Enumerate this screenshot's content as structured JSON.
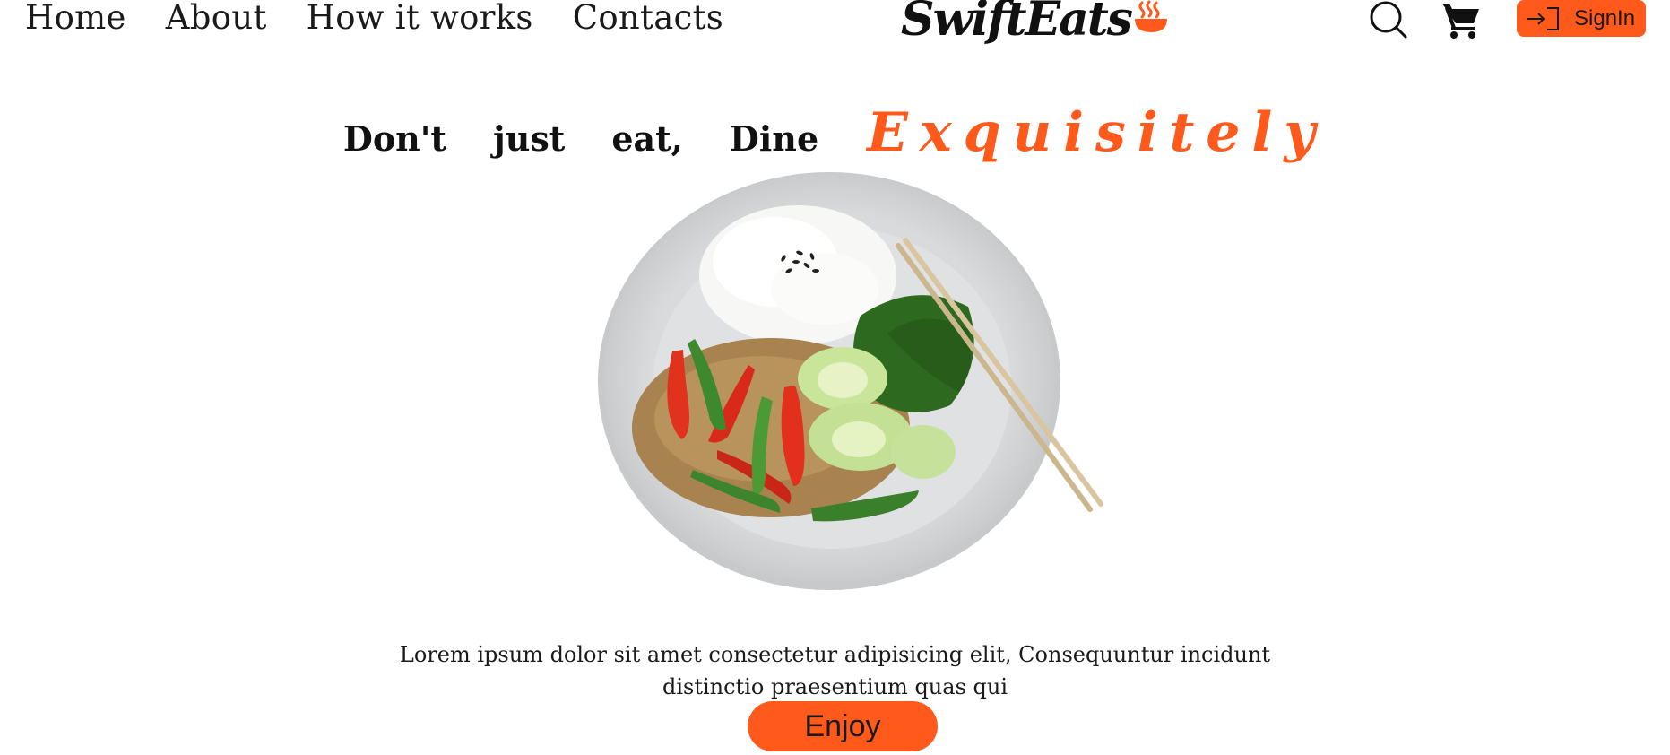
{
  "nav": {
    "links": [
      {
        "label": "Home"
      },
      {
        "label": "About"
      },
      {
        "label": "How it works"
      },
      {
        "label": "Contacts"
      }
    ]
  },
  "brand": {
    "name": "SwiftEats",
    "icon": "bowl-icon"
  },
  "header_actions": {
    "search_icon": "search-icon",
    "cart_icon": "cart-icon",
    "signin_label": "SignIn",
    "signin_icon": "signin-arrow-icon"
  },
  "hero": {
    "headline_words": [
      "Don't",
      "just",
      "eat,",
      "Dine"
    ],
    "headline_accent": "Exquisitely",
    "image_alt": "plate-of-stir-fry-with-rice",
    "description": "Lorem ipsum dolor sit amet consectetur adipisicing elit, Consequuntur incidunt distinctio praesentium quas qui",
    "cta_label": "Enjoy"
  },
  "colors": {
    "accent": "#ff5a1b",
    "text": "#111111",
    "background": "#ffffff"
  }
}
